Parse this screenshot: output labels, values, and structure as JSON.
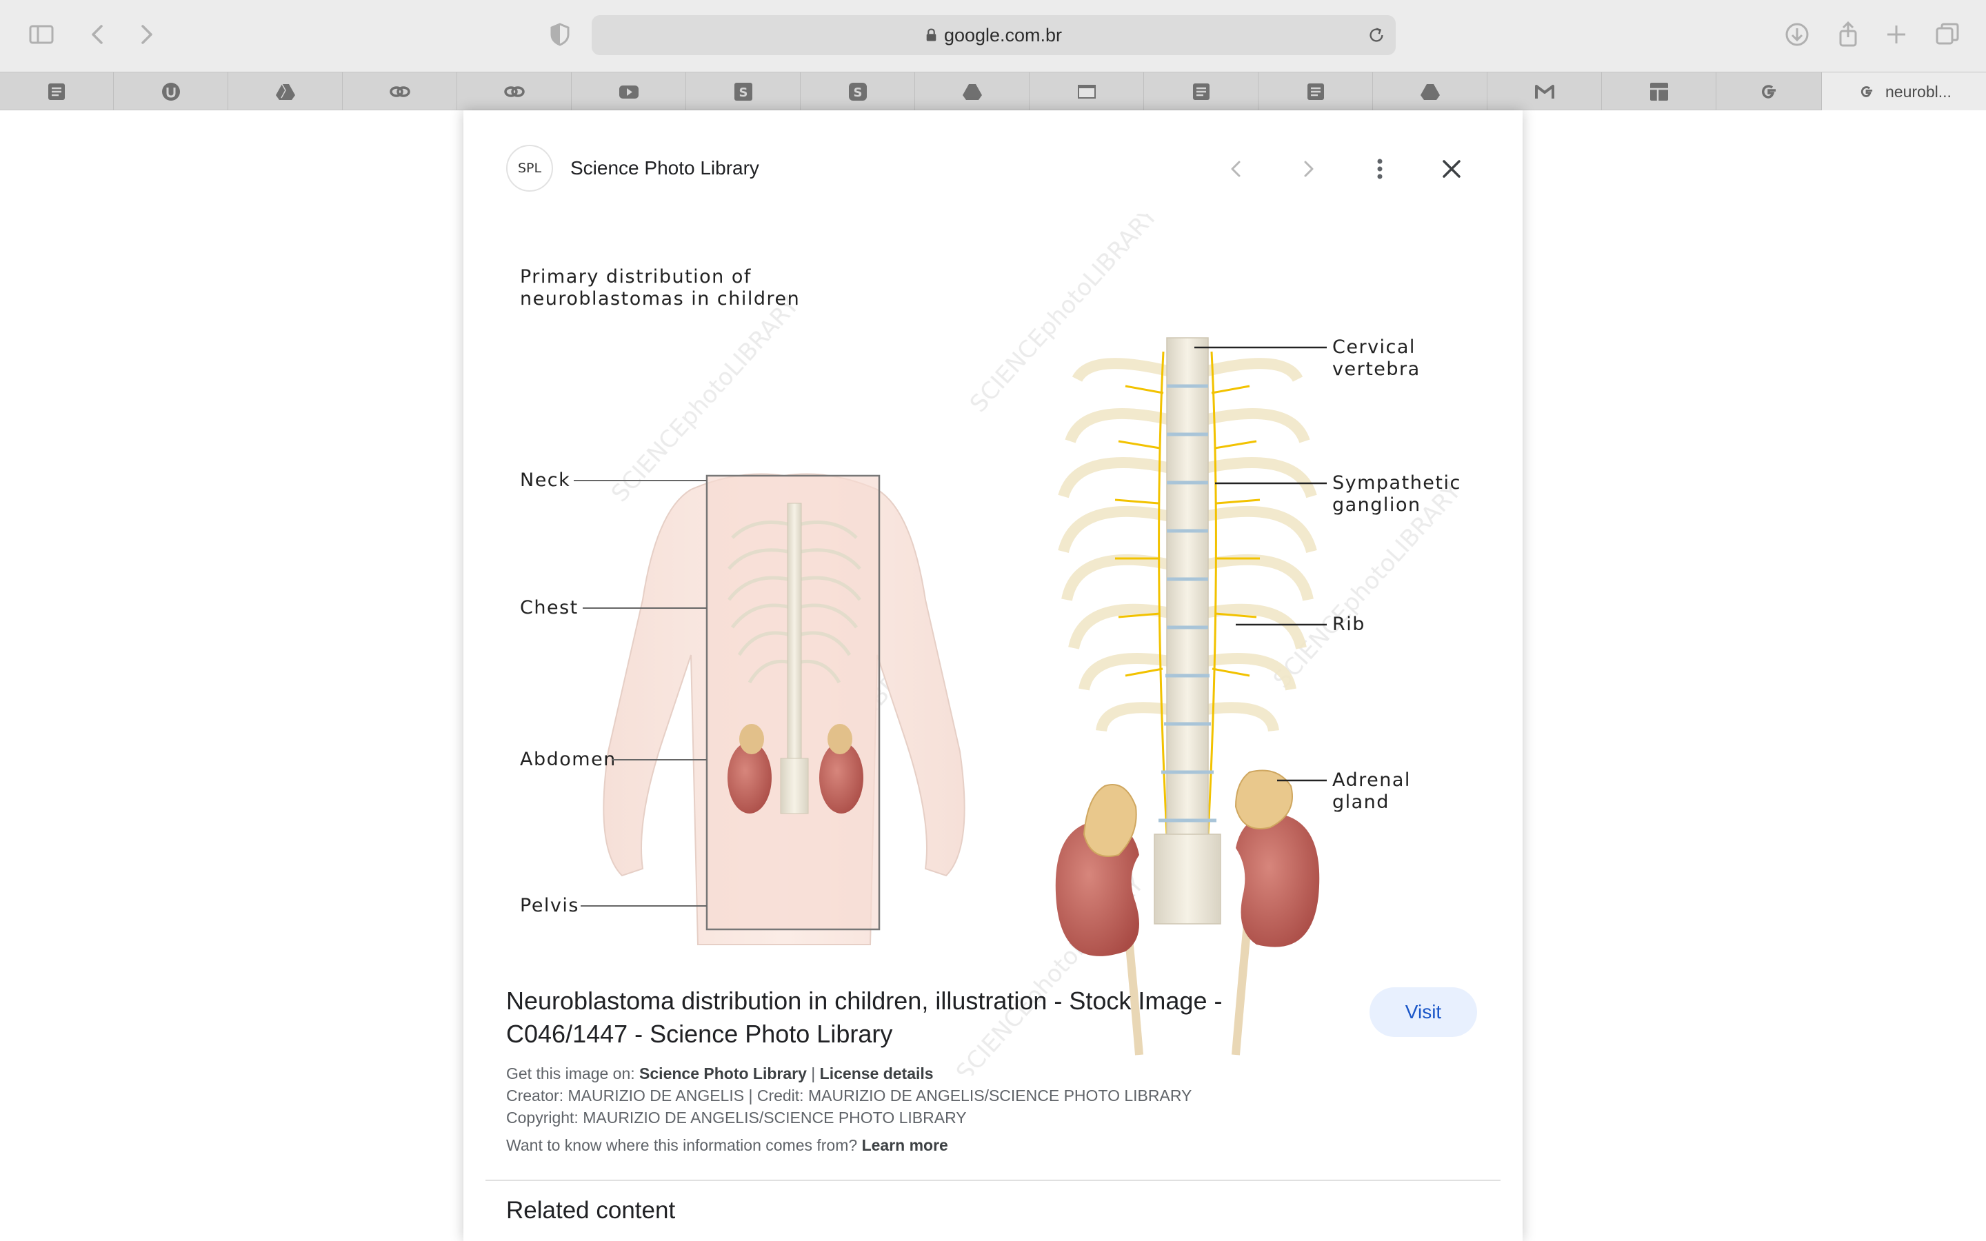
{
  "browser": {
    "address": "google.com.br",
    "active_tab_title": "neurobl...",
    "tab_icons": [
      "doc-icon",
      "udemy-icon",
      "drive-icon",
      "link-icon",
      "link-icon",
      "youtube-icon",
      "s-app-icon",
      "s-app-icon",
      "drive-icon",
      "window-icon",
      "doc-icon",
      "doc-icon",
      "drive-icon",
      "gmail-icon",
      "grid-icon",
      "google-icon"
    ]
  },
  "panel": {
    "logo_text": "SPL",
    "source_name": "Science Photo Library",
    "title": "Neuroblastoma distribution in children, illustration - Stock Image - C046/1447 - Science Photo Library",
    "visit_label": "Visit",
    "get_image_label": "Get this image on:",
    "get_image_source": "Science Photo Library",
    "separator": "|",
    "license_label": "License details",
    "creator_line": "Creator: MAURIZIO DE ANGELIS | Credit: MAURIZIO DE ANGELIS/SCIENCE PHOTO LIBRARY",
    "copyright_line": "Copyright: MAURIZIO DE ANGELIS/SCIENCE PHOTO LIBRARY",
    "info_question": "Want to know where this information comes from?",
    "learn_more": "Learn more",
    "related_heading": "Related content"
  },
  "illustration": {
    "heading_line1": "Primary distribution of",
    "heading_line2": "neuroblastomas in children",
    "left_labels": [
      "Neck",
      "Chest",
      "Abdomen",
      "Pelvis"
    ],
    "right_labels": {
      "cervical_1": "Cervical",
      "cervical_2": "vertebra",
      "sympathetic_1": "Sympathetic",
      "sympathetic_2": "ganglion",
      "rib": "Rib",
      "adrenal_1": "Adrenal",
      "adrenal_2": "gland"
    },
    "watermark": "SCIENCEphotoLIBRARY"
  }
}
